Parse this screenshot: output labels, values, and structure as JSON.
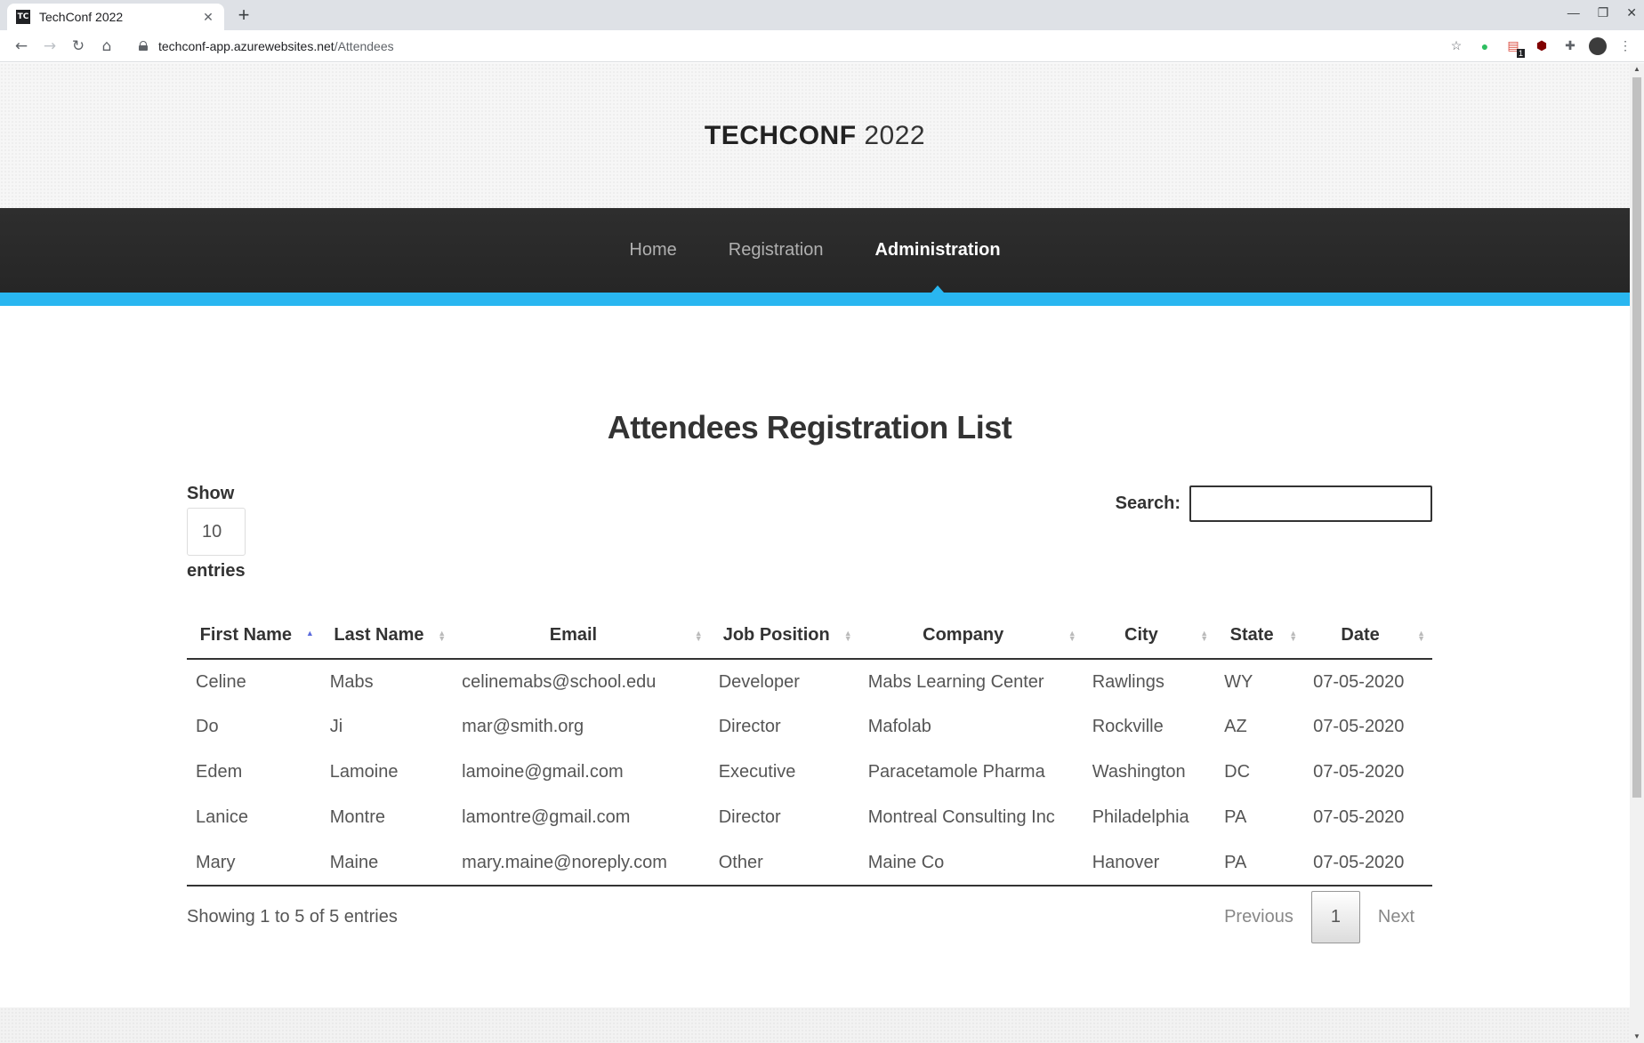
{
  "browser": {
    "tab_title": "TechConf 2022",
    "tab_favicon_text": "TC",
    "url_host": "techconf-app.azurewebsites.net",
    "url_path": "/Attendees",
    "extension_badge": "1"
  },
  "header": {
    "brand_bold": "TECHCONF",
    "brand_year": "2022"
  },
  "nav": {
    "items": [
      {
        "label": "Home",
        "active": false
      },
      {
        "label": "Registration",
        "active": false
      },
      {
        "label": "Administration",
        "active": true
      }
    ],
    "accent_color": "#29b6f0"
  },
  "main": {
    "heading": "Attendees Registration List",
    "length": {
      "label_before": "Show",
      "value": "10",
      "label_after": "entries"
    },
    "search": {
      "label": "Search:",
      "value": "",
      "placeholder": ""
    },
    "table": {
      "columns": [
        "First Name",
        "Last Name",
        "Email",
        "Job Position",
        "Company",
        "City",
        "State",
        "Date"
      ],
      "sorted_column": "First Name",
      "sort_direction": "ascending",
      "rows": [
        [
          "Celine",
          "Mabs",
          "celinemabs@school.edu",
          "Developer",
          "Mabs Learning Center",
          "Rawlings",
          "WY",
          "07-05-2020"
        ],
        [
          "Do",
          "Ji",
          "mar@smith.org",
          "Director",
          "Mafolab",
          "Rockville",
          "AZ",
          "07-05-2020"
        ],
        [
          "Edem",
          "Lamoine",
          "lamoine@gmail.com",
          "Executive",
          "Paracetamole Pharma",
          "Washington",
          "DC",
          "07-05-2020"
        ],
        [
          "Lanice",
          "Montre",
          "lamontre@gmail.com",
          "Director",
          "Montreal Consulting Inc",
          "Philadelphia",
          "PA",
          "07-05-2020"
        ],
        [
          "Mary",
          "Maine",
          "mary.maine@noreply.com",
          "Other",
          "Maine Co",
          "Hanover",
          "PA",
          "07-05-2020"
        ]
      ]
    },
    "info": "Showing 1 to 5 of 5 entries",
    "pagination": {
      "previous": "Previous",
      "current": "1",
      "next": "Next"
    }
  }
}
